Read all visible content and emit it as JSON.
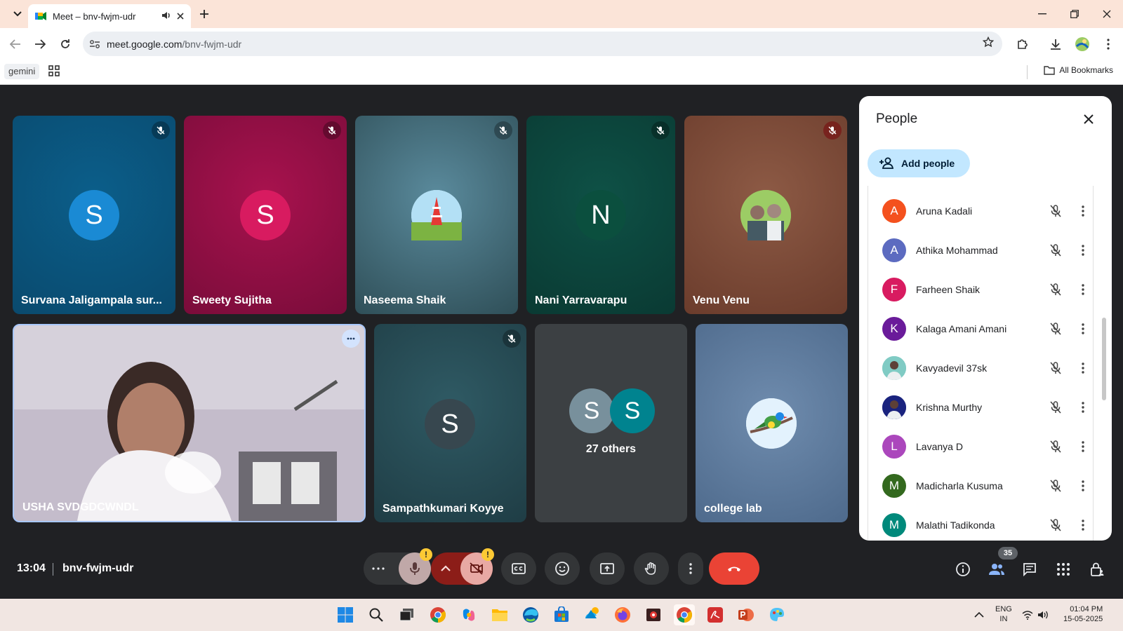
{
  "browser": {
    "tab_title": "Meet – bnv-fwjm-udr",
    "url_host": "meet.google.com",
    "url_path": "/bnv-fwjm-udr",
    "bookmark_gemini": "gemini",
    "all_bookmarks": "All Bookmarks"
  },
  "tiles": [
    {
      "name": "Survana Jaligampala sur...",
      "initial": "S",
      "avatar_color": "#1a8ad4",
      "muted": true
    },
    {
      "name": "Sweety Sujitha",
      "initial": "S",
      "avatar_color": "#d81b60",
      "muted": true
    },
    {
      "name": "Naseema Shaik",
      "initial": "",
      "avatar_type": "photo-tower",
      "muted": true
    },
    {
      "name": "Nani Yarravarapu",
      "initial": "N",
      "avatar_color": "#0b4f3e",
      "muted": true
    },
    {
      "name": "Venu Venu",
      "initial": "",
      "avatar_type": "photo-selfie",
      "muted": true
    },
    {
      "name": "USHA SVDGDCWNDL",
      "video": true,
      "pinned": true
    },
    {
      "name": "Sampathkumari Koyye",
      "initial": "S",
      "avatar_color": "#37474f",
      "muted": true
    },
    {
      "name": "27 others",
      "initials": [
        "S",
        "S"
      ],
      "avatar_colors": [
        "#78909c",
        "#00838f"
      ]
    },
    {
      "name": "college lab",
      "initial": "",
      "avatar_type": "photo-bird"
    }
  ],
  "people_panel": {
    "title": "People",
    "add_people": "Add people",
    "participants": [
      {
        "name": "Aruna Kadali",
        "initial": "A",
        "color": "#f4511e"
      },
      {
        "name": "Athika Mohammad",
        "initial": "A",
        "color": "#5c6bc0"
      },
      {
        "name": "Farheen Shaik",
        "initial": "F",
        "color": "#d81b60"
      },
      {
        "name": "Kalaga Amani Amani",
        "initial": "K",
        "color": "#6a1b9a"
      },
      {
        "name": "Kavyadevil 37sk",
        "initial": "",
        "color": "#80cbc4",
        "photo": true
      },
      {
        "name": "Krishna Murthy",
        "initial": "",
        "color": "#1a237e",
        "photo": true
      },
      {
        "name": "Lavanya D",
        "initial": "L",
        "color": "#ab47bc"
      },
      {
        "name": "Madicharla Kusuma",
        "initial": "M",
        "color": "#33691e"
      },
      {
        "name": "Malathi Tadikonda",
        "initial": "M",
        "color": "#00897b"
      }
    ]
  },
  "bottom": {
    "time": "13:04",
    "meeting_code": "bnv-fwjm-udr",
    "people_count": "35"
  },
  "taskbar": {
    "lang_1": "ENG",
    "lang_2": "IN",
    "time": "01:04 PM",
    "date": "15-05-2025"
  }
}
